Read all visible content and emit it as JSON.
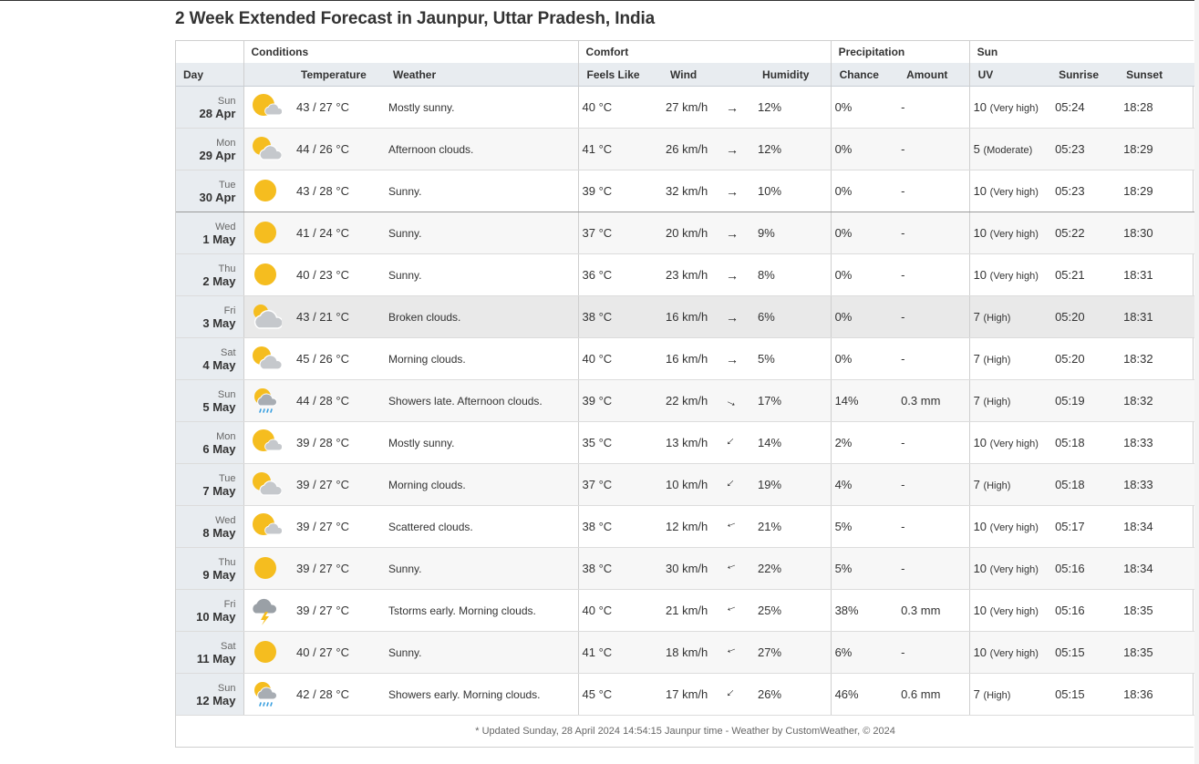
{
  "page_title": "2 Week Extended Forecast in Jaunpur, Uttar Pradesh, India",
  "groups": {
    "conditions": "Conditions",
    "comfort": "Comfort",
    "precipitation": "Precipitation",
    "sun": "Sun"
  },
  "columns": {
    "day": "Day",
    "temperature": "Temperature",
    "weather": "Weather",
    "feels_like": "Feels Like",
    "wind": "Wind",
    "humidity": "Humidity",
    "chance": "Chance",
    "amount": "Amount",
    "uv": "UV",
    "sunrise": "Sunrise",
    "sunset": "Sunset"
  },
  "colors": {
    "sun": "#f5bd1f",
    "cloud": "#c5c8cc",
    "rain": "#3aa0e0",
    "bolt": "#f5bd1f",
    "header_bg": "#e8ecf0"
  },
  "rows": [
    {
      "dow": "Sun",
      "date": "28 Apr",
      "icon": "partly-sunny-icon",
      "temp": "43 / 27 °C",
      "weather": "Mostly sunny.",
      "feels": "40 °C",
      "wind": "27 km/h",
      "wind_arrow": "→",
      "wind_deg": 0,
      "humidity": "12%",
      "chance": "0%",
      "amount": "-",
      "uv": "10",
      "uv_label": "(Very high)",
      "sunrise": "05:24",
      "sunset": "18:28"
    },
    {
      "dow": "Mon",
      "date": "29 Apr",
      "icon": "sun-cloud-icon",
      "temp": "44 / 26 °C",
      "weather": "Afternoon clouds.",
      "feels": "41 °C",
      "wind": "26 km/h",
      "wind_arrow": "→",
      "wind_deg": 0,
      "humidity": "12%",
      "chance": "0%",
      "amount": "-",
      "uv": "5",
      "uv_label": "(Moderate)",
      "sunrise": "05:23",
      "sunset": "18:29"
    },
    {
      "dow": "Tue",
      "date": "30 Apr",
      "icon": "sun-icon",
      "temp": "43 / 28 °C",
      "weather": "Sunny.",
      "feels": "39 °C",
      "wind": "32 km/h",
      "wind_arrow": "→",
      "wind_deg": 0,
      "humidity": "10%",
      "chance": "0%",
      "amount": "-",
      "uv": "10",
      "uv_label": "(Very high)",
      "sunrise": "05:23",
      "sunset": "18:29"
    },
    {
      "dow": "Wed",
      "date": "1 May",
      "icon": "sun-icon",
      "temp": "41 / 24 °C",
      "weather": "Sunny.",
      "feels": "37 °C",
      "wind": "20 km/h",
      "wind_arrow": "→",
      "wind_deg": 0,
      "humidity": "9%",
      "chance": "0%",
      "amount": "-",
      "uv": "10",
      "uv_label": "(Very high)",
      "sunrise": "05:22",
      "sunset": "18:30"
    },
    {
      "dow": "Thu",
      "date": "2 May",
      "icon": "sun-icon",
      "temp": "40 / 23 °C",
      "weather": "Sunny.",
      "feels": "36 °C",
      "wind": "23 km/h",
      "wind_arrow": "→",
      "wind_deg": 0,
      "humidity": "8%",
      "chance": "0%",
      "amount": "-",
      "uv": "10",
      "uv_label": "(Very high)",
      "sunrise": "05:21",
      "sunset": "18:31"
    },
    {
      "dow": "Fri",
      "date": "3 May",
      "icon": "cloudy-icon",
      "temp": "43 / 21 °C",
      "weather": "Broken clouds.",
      "feels": "38 °C",
      "wind": "16 km/h",
      "wind_arrow": "→",
      "wind_deg": 0,
      "humidity": "6%",
      "chance": "0%",
      "amount": "-",
      "uv": "7",
      "uv_label": "(High)",
      "sunrise": "05:20",
      "sunset": "18:31"
    },
    {
      "dow": "Sat",
      "date": "4 May",
      "icon": "sun-cloud-icon",
      "temp": "45 / 26 °C",
      "weather": "Morning clouds.",
      "feels": "40 °C",
      "wind": "16 km/h",
      "wind_arrow": "→",
      "wind_deg": 0,
      "humidity": "5%",
      "chance": "0%",
      "amount": "-",
      "uv": "7",
      "uv_label": "(High)",
      "sunrise": "05:20",
      "sunset": "18:32"
    },
    {
      "dow": "Sun",
      "date": "5 May",
      "icon": "showers-icon",
      "temp": "44 / 28 °C",
      "weather": "Showers late. Afternoon clouds.",
      "feels": "39 °C",
      "wind": "22 km/h",
      "wind_arrow": "→",
      "wind_deg": 25,
      "humidity": "17%",
      "chance": "14%",
      "amount": "0.3 mm",
      "uv": "7",
      "uv_label": "(High)",
      "sunrise": "05:19",
      "sunset": "18:32"
    },
    {
      "dow": "Mon",
      "date": "6 May",
      "icon": "partly-sunny-icon",
      "temp": "39 / 28 °C",
      "weather": "Mostly sunny.",
      "feels": "35 °C",
      "wind": "13 km/h",
      "wind_arrow": "→",
      "wind_deg": 135,
      "humidity": "14%",
      "chance": "2%",
      "amount": "-",
      "uv": "10",
      "uv_label": "(Very high)",
      "sunrise": "05:18",
      "sunset": "18:33"
    },
    {
      "dow": "Tue",
      "date": "7 May",
      "icon": "sun-cloud-icon",
      "temp": "39 / 27 °C",
      "weather": "Morning clouds.",
      "feels": "37 °C",
      "wind": "10 km/h",
      "wind_arrow": "→",
      "wind_deg": 135,
      "humidity": "19%",
      "chance": "4%",
      "amount": "-",
      "uv": "7",
      "uv_label": "(High)",
      "sunrise": "05:18",
      "sunset": "18:33"
    },
    {
      "dow": "Wed",
      "date": "8 May",
      "icon": "partly-sunny-icon",
      "temp": "39 / 27 °C",
      "weather": "Scattered clouds.",
      "feels": "38 °C",
      "wind": "12 km/h",
      "wind_arrow": "→",
      "wind_deg": 160,
      "humidity": "21%",
      "chance": "5%",
      "amount": "-",
      "uv": "10",
      "uv_label": "(Very high)",
      "sunrise": "05:17",
      "sunset": "18:34"
    },
    {
      "dow": "Thu",
      "date": "9 May",
      "icon": "sun-icon",
      "temp": "39 / 27 °C",
      "weather": "Sunny.",
      "feels": "38 °C",
      "wind": "30 km/h",
      "wind_arrow": "→",
      "wind_deg": 160,
      "humidity": "22%",
      "chance": "5%",
      "amount": "-",
      "uv": "10",
      "uv_label": "(Very high)",
      "sunrise": "05:16",
      "sunset": "18:34"
    },
    {
      "dow": "Fri",
      "date": "10 May",
      "icon": "thunderstorm-icon",
      "temp": "39 / 27 °C",
      "weather": "Tstorms early. Morning clouds.",
      "feels": "40 °C",
      "wind": "21 km/h",
      "wind_arrow": "→",
      "wind_deg": 160,
      "humidity": "25%",
      "chance": "38%",
      "amount": "0.3 mm",
      "uv": "10",
      "uv_label": "(Very high)",
      "sunrise": "05:16",
      "sunset": "18:35"
    },
    {
      "dow": "Sat",
      "date": "11 May",
      "icon": "sun-icon",
      "temp": "40 / 27 °C",
      "weather": "Sunny.",
      "feels": "41 °C",
      "wind": "18 km/h",
      "wind_arrow": "→",
      "wind_deg": 160,
      "humidity": "27%",
      "chance": "6%",
      "amount": "-",
      "uv": "10",
      "uv_label": "(Very high)",
      "sunrise": "05:15",
      "sunset": "18:35"
    },
    {
      "dow": "Sun",
      "date": "12 May",
      "icon": "showers-icon",
      "temp": "42 / 28 °C",
      "weather": "Showers early. Morning clouds.",
      "feels": "45 °C",
      "wind": "17 km/h",
      "wind_arrow": "→",
      "wind_deg": 135,
      "humidity": "26%",
      "chance": "46%",
      "amount": "0.6 mm",
      "uv": "7",
      "uv_label": "(High)",
      "sunrise": "05:15",
      "sunset": "18:36"
    }
  ],
  "footer": "* Updated Sunday, 28 April 2024 14:54:15 Jaunpur time - Weather by CustomWeather, © 2024"
}
